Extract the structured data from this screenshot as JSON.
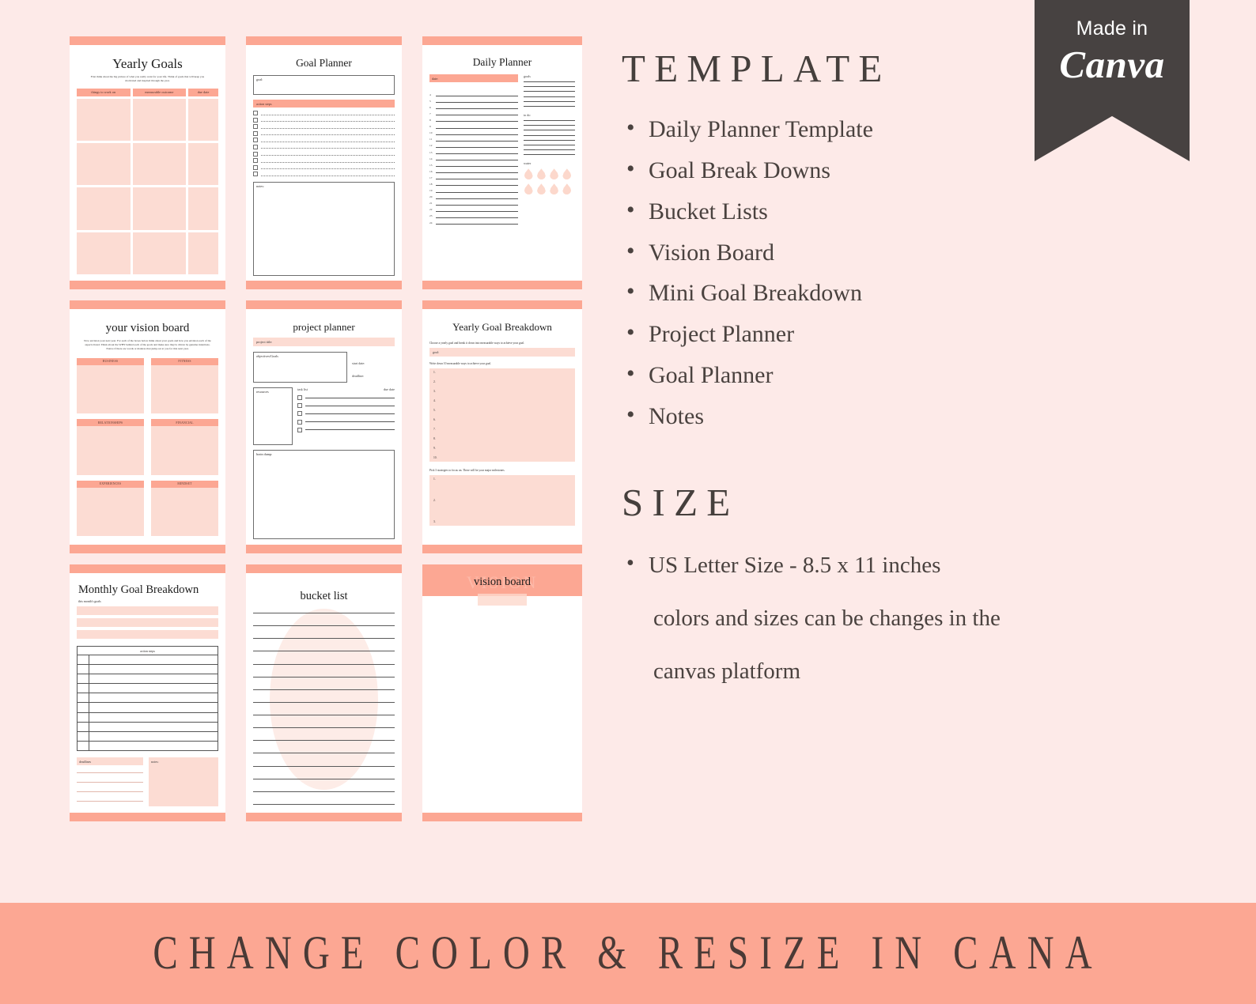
{
  "background_color": "#fdeae8",
  "accent_color": "#fca793",
  "accent_light_color": "#fcdcd3",
  "text_color": "#4a423f",
  "ribbon_color": "#474241",
  "badge": {
    "made_label": "Made in",
    "brand": "Canva"
  },
  "right": {
    "template_heading": "TEMPLATE",
    "template_items": [
      "Daily Planner Template",
      "Goal Break Downs",
      "Bucket Lists",
      "Vision Board",
      "Mini Goal Breakdown",
      "Project Planner",
      "Goal Planner",
      "Notes"
    ],
    "size_heading": "SIZE",
    "size_items": [
      "US Letter Size - 8.5 x 11 inches",
      "colors and sizes can be changes in the",
      "canvas platform"
    ]
  },
  "bottom_banner": {
    "text": "CHANGE COLOR & RESIZE IN CANA"
  },
  "pages": {
    "yearly_goals": {
      "title": "Yearly Goals",
      "description": "First think about the big picture of what you really want for your life. Think of goals that will keep you motivated and inspired through the year.",
      "columns": [
        "things to work on",
        "measurable outcome",
        "due date"
      ]
    },
    "goal_planner": {
      "title": "Goal Planner",
      "goal_label": "goal:",
      "action_steps_label": "action steps",
      "notes_label": "notes:",
      "step_count": 10
    },
    "daily_planner": {
      "title": "Daily Planner",
      "date_label": "date:",
      "goals_label": "goals",
      "todo_label": "to do",
      "water_label": "water",
      "hours": [
        "4",
        "5",
        "6",
        "7",
        "8",
        "9",
        "10",
        "11",
        "12",
        "13",
        "14",
        "15",
        "16",
        "17",
        "18",
        "19",
        "20",
        "21",
        "22",
        "23",
        "24"
      ],
      "goals_lines": 6,
      "todo_lines": 8,
      "water_drops": 8
    },
    "your_vision_board": {
      "title": "your vision board",
      "description": "Now envision your next year. For each of the boxes below think about your goals and how you envision each of the aspects listed. Think about the WHY behind each of the goals and make sure they're driven by genuine intentions. Notice if there are words or mantras that jump out at you for this next year.",
      "categories": [
        "BUSINESS",
        "FITNESS",
        "RELATIONSHIPS",
        "FINANCIAL",
        "EXPERIENCES",
        "MINDSET"
      ]
    },
    "project_planner": {
      "title": "project planner",
      "project_title_label": "project title:",
      "objectives_label": "objectives/Goals",
      "start_date_label": "start date:",
      "deadline_label": "deadline:",
      "resources_label": "resources",
      "task_list_label": "task list",
      "due_date_label": "due date",
      "brain_dump_label": "brain dump:",
      "task_count": 5
    },
    "yearly_goal_breakdown": {
      "title": "Yearly Goal Breakdown",
      "intro": "Choose a yearly goal and break it down into measurable ways to achieve your goal.",
      "goal_label": "goal:",
      "instruction_ten": "Write down 10 measurable ways to achieve your goal.",
      "numbers_ten": [
        "1.",
        "2.",
        "3.",
        "4.",
        "5.",
        "6.",
        "7.",
        "8.",
        "9.",
        "10."
      ],
      "instruction_three": "Pick 3 strategies to focus on.  These will be your major milestones.",
      "numbers_three": [
        "1.",
        "2.",
        "3."
      ]
    },
    "monthly_goal_breakdown": {
      "title": "Monthly Goal Breakdown",
      "subtitle": "this month's goals",
      "goal_bars": 3,
      "action_steps_label": "action steps",
      "row_count": 10,
      "deadlines_label": "deadlines",
      "notes_label": "notes:"
    },
    "bucket_list": {
      "title": "bucket list",
      "line_count": 16
    },
    "vision_board": {
      "title": "vision board",
      "ghost_text": "VISION"
    }
  }
}
